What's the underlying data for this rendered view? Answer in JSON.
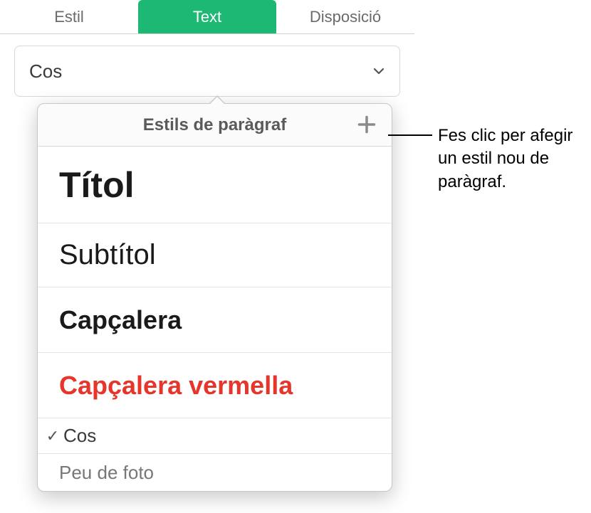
{
  "tabs": {
    "style": "Estil",
    "text": "Text",
    "layout": "Disposició",
    "active": "text"
  },
  "dropdown": {
    "value": "Cos"
  },
  "popover": {
    "title": "Estils de paràgraf"
  },
  "styles": {
    "titol": "Títol",
    "subtitol": "Subtítol",
    "capcalera": "Capçalera",
    "capcalera_vermella": "Capçalera vermella",
    "cos": "Cos",
    "peu": "Peu de foto",
    "selected": "cos",
    "checkmark": "✓"
  },
  "callout": {
    "text": "Fes clic per afegir un estil nou de paràgraf."
  },
  "colors": {
    "accent": "#1db874",
    "warning_text": "#e6352b"
  }
}
